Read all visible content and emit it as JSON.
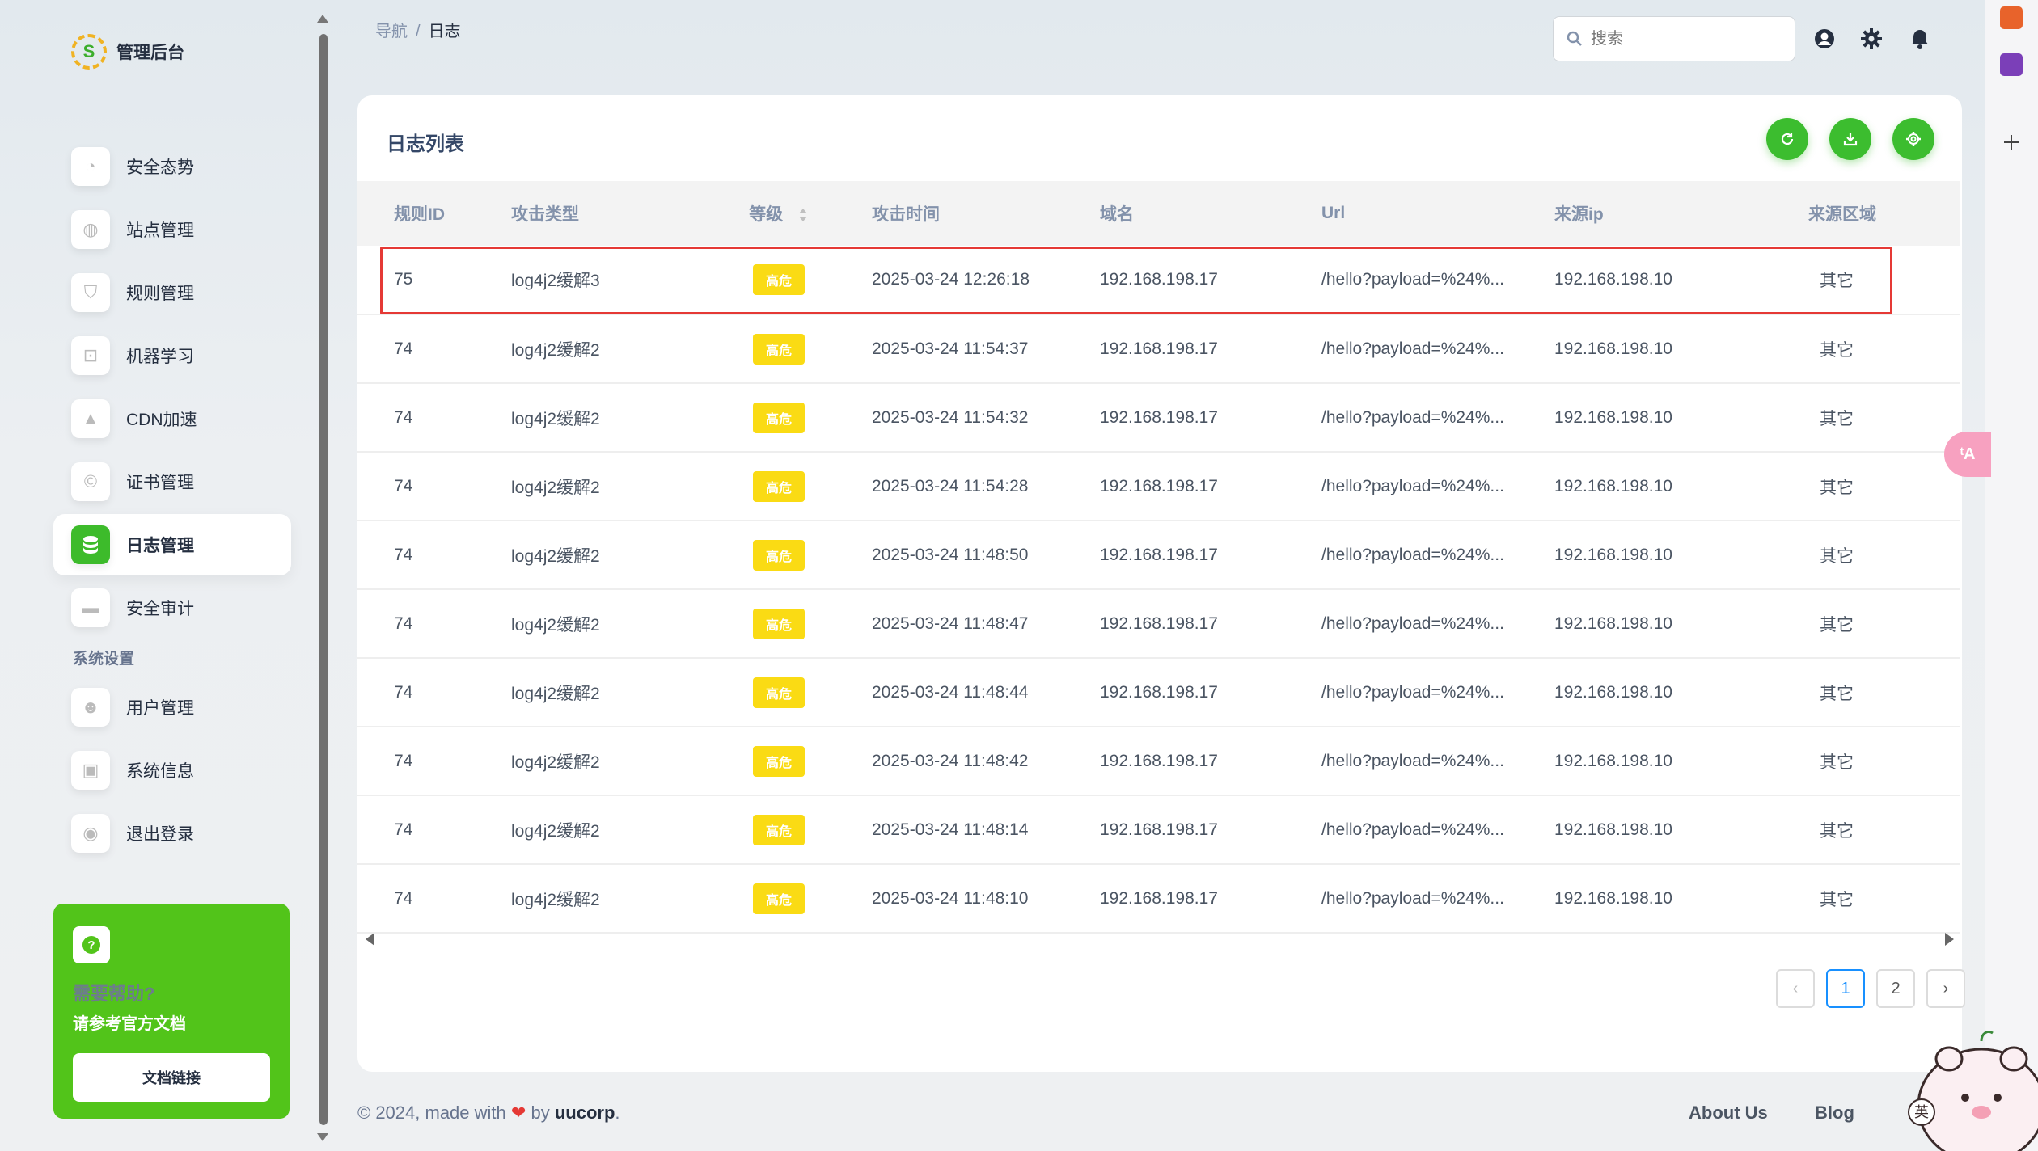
{
  "brand": {
    "logo_letter": "S",
    "title": "管理后台"
  },
  "sidebar": {
    "items": [
      {
        "label": "安全态势",
        "icon": "dashboard-icon",
        "active": false
      },
      {
        "label": "站点管理",
        "icon": "globe-icon",
        "active": false
      },
      {
        "label": "规则管理",
        "icon": "shield-icon",
        "active": false
      },
      {
        "label": "机器学习",
        "icon": "robot-icon",
        "active": false
      },
      {
        "label": "CDN加速",
        "icon": "cdn-icon",
        "active": false
      },
      {
        "label": "证书管理",
        "icon": "certificate-icon",
        "active": false
      },
      {
        "label": "日志管理",
        "icon": "database-icon",
        "active": true
      },
      {
        "label": "安全审计",
        "icon": "monitor-icon",
        "active": false
      }
    ],
    "section_title": "系统设置",
    "system_items": [
      {
        "label": "用户管理",
        "icon": "user-icon"
      },
      {
        "label": "系统信息",
        "icon": "info-icon"
      },
      {
        "label": "退出登录",
        "icon": "logout-icon"
      }
    ],
    "help": {
      "line1": "需要帮助?",
      "line2": "请参考官方文档",
      "button": "文档链接"
    }
  },
  "topbar": {
    "breadcrumb": {
      "parent": "导航",
      "separator": "/",
      "current": "日志"
    },
    "search_placeholder": "搜索"
  },
  "card": {
    "title": "日志列表",
    "actions": [
      "refresh-icon",
      "download-icon",
      "settings-icon"
    ]
  },
  "table": {
    "columns": [
      "规则ID",
      "攻击类型",
      "等级",
      "攻击时间",
      "域名",
      "Url",
      "来源ip",
      "来源区域"
    ],
    "rows": [
      {
        "id": "75",
        "type": "log4j2缓解3",
        "level": "高危",
        "time": "2025-03-24 12:26:18",
        "domain": "192.168.198.17",
        "url": "/hello?payload=%24%...",
        "ip": "192.168.198.10",
        "region": "其它"
      },
      {
        "id": "74",
        "type": "log4j2缓解2",
        "level": "高危",
        "time": "2025-03-24 11:54:37",
        "domain": "192.168.198.17",
        "url": "/hello?payload=%24%...",
        "ip": "192.168.198.10",
        "region": "其它"
      },
      {
        "id": "74",
        "type": "log4j2缓解2",
        "level": "高危",
        "time": "2025-03-24 11:54:32",
        "domain": "192.168.198.17",
        "url": "/hello?payload=%24%...",
        "ip": "192.168.198.10",
        "region": "其它"
      },
      {
        "id": "74",
        "type": "log4j2缓解2",
        "level": "高危",
        "time": "2025-03-24 11:54:28",
        "domain": "192.168.198.17",
        "url": "/hello?payload=%24%...",
        "ip": "192.168.198.10",
        "region": "其它"
      },
      {
        "id": "74",
        "type": "log4j2缓解2",
        "level": "高危",
        "time": "2025-03-24 11:48:50",
        "domain": "192.168.198.17",
        "url": "/hello?payload=%24%...",
        "ip": "192.168.198.10",
        "region": "其它"
      },
      {
        "id": "74",
        "type": "log4j2缓解2",
        "level": "高危",
        "time": "2025-03-24 11:48:47",
        "domain": "192.168.198.17",
        "url": "/hello?payload=%24%...",
        "ip": "192.168.198.10",
        "region": "其它"
      },
      {
        "id": "74",
        "type": "log4j2缓解2",
        "level": "高危",
        "time": "2025-03-24 11:48:44",
        "domain": "192.168.198.17",
        "url": "/hello?payload=%24%...",
        "ip": "192.168.198.10",
        "region": "其它"
      },
      {
        "id": "74",
        "type": "log4j2缓解2",
        "level": "高危",
        "time": "2025-03-24 11:48:42",
        "domain": "192.168.198.17",
        "url": "/hello?payload=%24%...",
        "ip": "192.168.198.10",
        "region": "其它"
      },
      {
        "id": "74",
        "type": "log4j2缓解2",
        "level": "高危",
        "time": "2025-03-24 11:48:14",
        "domain": "192.168.198.17",
        "url": "/hello?payload=%24%...",
        "ip": "192.168.198.10",
        "region": "其它"
      },
      {
        "id": "74",
        "type": "log4j2缓解2",
        "level": "高危",
        "time": "2025-03-24 11:48:10",
        "domain": "192.168.198.17",
        "url": "/hello?payload=%24%...",
        "ip": "192.168.198.10",
        "region": "其它"
      }
    ]
  },
  "pagination": {
    "prev": "‹",
    "pages": [
      "1",
      "2"
    ],
    "current": "1",
    "next": "›"
  },
  "footer": {
    "prefix": "© 2024, made with",
    "heart": "❤",
    "by": "by",
    "brand": "uucorp",
    "suffix": ".",
    "links": [
      "About Us",
      "Blog"
    ]
  },
  "overlay": {
    "translate_label": "ᵗA",
    "ime_badge": "英"
  },
  "colors": {
    "accent": "#3cbd2f",
    "help_bg": "#52c41a",
    "badge": "#fadb14",
    "highlight": "#e53935",
    "page_active": "#1890ff"
  }
}
